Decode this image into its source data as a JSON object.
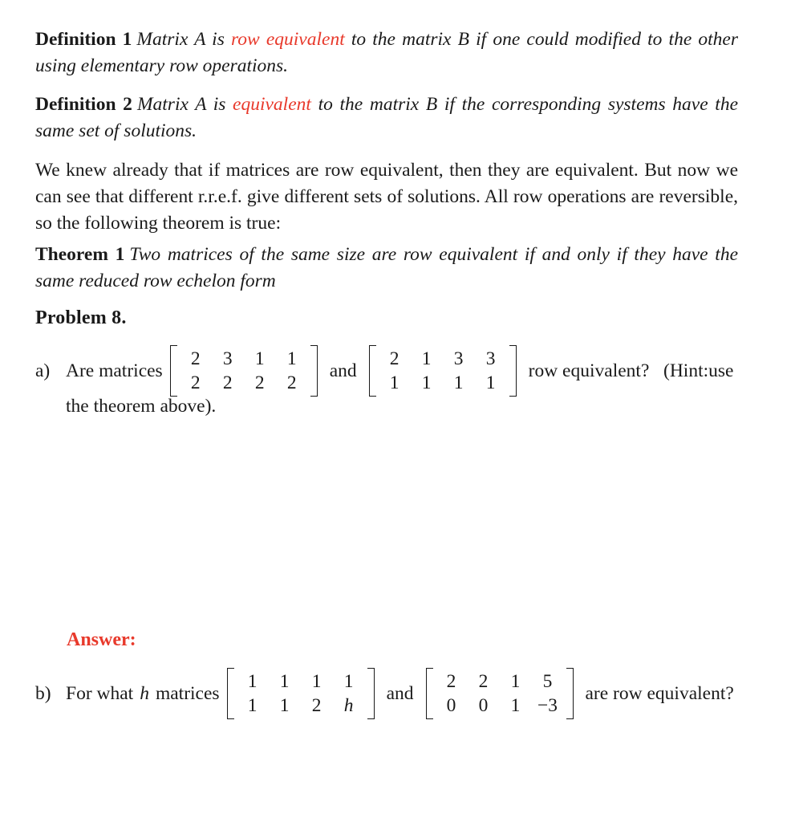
{
  "document": {
    "type": "math-worksheet",
    "accent_color": "#e8392b",
    "text_color": "#1a1a1a",
    "background": "#ffffff"
  },
  "definitions": [
    {
      "label": "Definition 1",
      "text_before": "Matrix A is ",
      "highlight": "row equivalent",
      "text_after": " to the matrix B if one could modified to the other using elementary row operations."
    },
    {
      "label": "Definition 2",
      "text_before": "Matrix A is ",
      "highlight": "equivalent",
      "text_after": " to the matrix B if the corresponding systems have the same set of solutions."
    }
  ],
  "paragraph": "We knew already that if matrices are row equivalent, then they are equivalent. But now we can see that different r.r.e.f. give different sets of solutions. All row operations are reversible, so the following theorem is true:",
  "theorem": {
    "label": "Theorem 1",
    "text": "Two matrices of the same size are row equivalent if and only if they have the same reduced row echelon form"
  },
  "problem": {
    "heading": "Problem 8.",
    "parts": [
      {
        "label": "a)",
        "text_start": "Are matrices",
        "matrix_1": [
          [
            "2",
            "3",
            "1",
            "1"
          ],
          [
            "2",
            "2",
            "2",
            "2"
          ]
        ],
        "text_mid": "and",
        "matrix_2": [
          [
            "2",
            "1",
            "3",
            "3"
          ],
          [
            "1",
            "1",
            "1",
            "1"
          ]
        ],
        "text_end": "row equivalent?   (Hint:use",
        "text_continuation": "the theorem above).",
        "answer_label": "Answer:"
      },
      {
        "label": "b)",
        "text_start_1": "For what",
        "variable": "h",
        "text_start_2": "matrices",
        "matrix_1": [
          [
            "1",
            "1",
            "1",
            "1"
          ],
          [
            "1",
            "1",
            "2",
            "h"
          ]
        ],
        "matrix_1_italic_cells": [
          "1-3"
        ],
        "text_mid": "and",
        "matrix_2": [
          [
            "2",
            "2",
            "1",
            "5"
          ],
          [
            "0",
            "0",
            "1",
            "−3"
          ]
        ],
        "text_end": "are row equivalent?"
      }
    ]
  }
}
